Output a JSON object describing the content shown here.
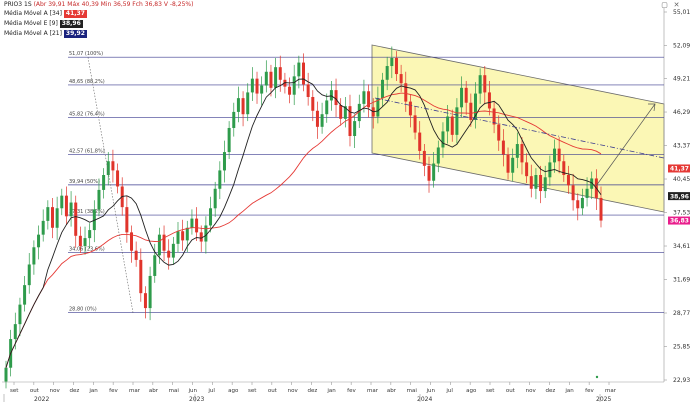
{
  "header": {
    "ticker": "PRIO3 1S",
    "ohlc_prefix": "(Abr 39,91 Máx 40,39 Min 36,59 Fch 36,83 V -8,25%)"
  },
  "legend": [
    {
      "label": "Média Móvel A [34]",
      "value": "41,37",
      "color": "#e53935"
    },
    {
      "label": "Média Móvel E [9]",
      "value": "38,96",
      "color": "#212121"
    },
    {
      "label": "Média Móvel A [21]",
      "value": "39,92",
      "color": "#1a237e"
    }
  ],
  "chart_data": {
    "type": "candlestick",
    "y_ticks": [
      "55,01",
      "52,09",
      "49,21",
      "46,29",
      "43,37",
      "40,45",
      "37,53",
      "34,61",
      "31,69",
      "28,77",
      "25,85",
      "22,93"
    ],
    "y_range": [
      22.93,
      55.01
    ],
    "x_months": [
      "set",
      "out",
      "nov",
      "dez",
      "jan",
      "fev",
      "mar",
      "abr",
      "mai",
      "jun",
      "jul",
      "ago",
      "set",
      "out",
      "nov",
      "dez",
      "jan",
      "fev",
      "mar",
      "abr",
      "mai",
      "jun",
      "jul",
      "ago",
      "set",
      "out",
      "nov",
      "dez",
      "jan",
      "fev",
      "mar"
    ],
    "x_years": [
      "2022",
      "2023",
      "2024",
      "2025"
    ],
    "fib_levels": [
      {
        "label": "51,07 (100%)",
        "value": 51.07
      },
      {
        "label": "48,65 (88,2%)",
        "value": 48.65
      },
      {
        "label": "45,82 (76,4%)",
        "value": 45.82
      },
      {
        "label": "42,57 (61,8%)",
        "value": 42.57
      },
      {
        "label": "39,94 (50%)",
        "value": 39.94
      },
      {
        "label": "37,31 (38,2%)",
        "value": 37.31
      },
      {
        "label": "34,06 (23,6%)",
        "value": 34.06
      },
      {
        "label": "28,80 (0%)",
        "value": 28.8
      }
    ],
    "price_labels": [
      {
        "value": "41,37",
        "num": 41.37,
        "color": "#e53935"
      },
      {
        "value": "38,96",
        "num": 38.96,
        "color": "#212121"
      },
      {
        "value": "36,83",
        "num": 36.83,
        "color": "#e91e8c"
      }
    ],
    "closes": [
      24.0,
      26.5,
      27.8,
      29.5,
      31.2,
      33.0,
      34.5,
      35.6,
      36.8,
      38.0,
      36.2,
      37.9,
      39.0,
      37.2,
      38.4,
      35.5,
      34.6,
      35.3,
      36.0,
      37.8,
      39.5,
      40.8,
      42.0,
      41.2,
      39.8,
      38.0,
      35.8,
      34.2,
      33.4,
      30.5,
      29.2,
      32.0,
      33.8,
      35.6,
      34.2,
      33.6,
      34.8,
      35.9,
      35.1,
      36.2,
      37.0,
      35.8,
      35.0,
      36.4,
      37.9,
      39.6,
      41.2,
      42.8,
      44.9,
      46.3,
      47.5,
      46.1,
      48.0,
      49.2,
      47.9,
      48.6,
      49.8,
      48.4,
      50.2,
      49.1,
      48.5,
      47.8,
      49.4,
      50.6,
      48.7,
      47.6,
      46.4,
      45.0,
      46.1,
      47.3,
      48.2,
      46.9,
      45.7,
      46.8,
      44.2,
      45.5,
      47.0,
      48.1,
      46.7,
      45.9,
      47.5,
      49.1,
      50.3,
      51.0,
      49.6,
      48.8,
      47.2,
      46.0,
      44.5,
      42.9,
      41.6,
      40.3,
      41.8,
      43.2,
      44.6,
      45.9,
      44.3,
      46.7,
      48.4,
      47.1,
      45.6,
      47.9,
      49.5,
      48.0,
      46.6,
      45.2,
      43.8,
      42.6,
      41.0,
      42.3,
      43.5,
      41.9,
      40.7,
      39.6,
      40.8,
      39.4,
      40.6,
      41.9,
      43.1,
      42.0,
      40.8,
      39.9,
      38.6,
      37.9,
      38.8,
      39.6,
      40.5,
      38.8,
      36.83
    ]
  }
}
